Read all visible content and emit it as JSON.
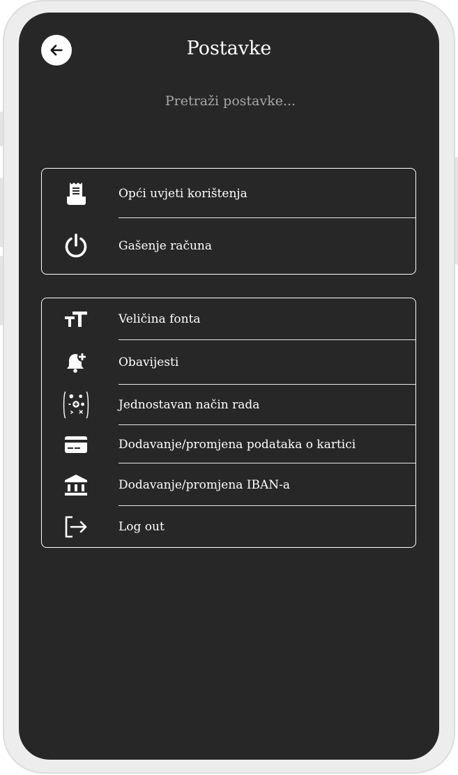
{
  "header": {
    "title": "Postavke",
    "back_icon": "arrow-left-icon"
  },
  "search": {
    "placeholder": "Pretraži postavke...",
    "value": ""
  },
  "groups": [
    {
      "items": [
        {
          "label": "Opći uvjeti korištenja",
          "icon": "receipt-icon"
        },
        {
          "label": "Gašenje računa",
          "icon": "power-icon"
        }
      ]
    },
    {
      "items": [
        {
          "label": "Veličina fonta",
          "icon": "font-size-icon"
        },
        {
          "label": "Obavijesti",
          "icon": "bell-plus-icon"
        },
        {
          "label": "Jednostavan način rada",
          "icon": "simple-mode-icon"
        },
        {
          "label": "Dodavanje/promjena podataka o kartici",
          "icon": "credit-card-icon"
        },
        {
          "label": "Dodavanje/promjena IBAN-a",
          "icon": "bank-icon"
        },
        {
          "label": "Log out",
          "icon": "logout-icon"
        }
      ]
    }
  ],
  "colors": {
    "screen_background": "#272727",
    "frame": "#ededed",
    "text": "#ffffff",
    "placeholder": "#a9a9a9"
  }
}
